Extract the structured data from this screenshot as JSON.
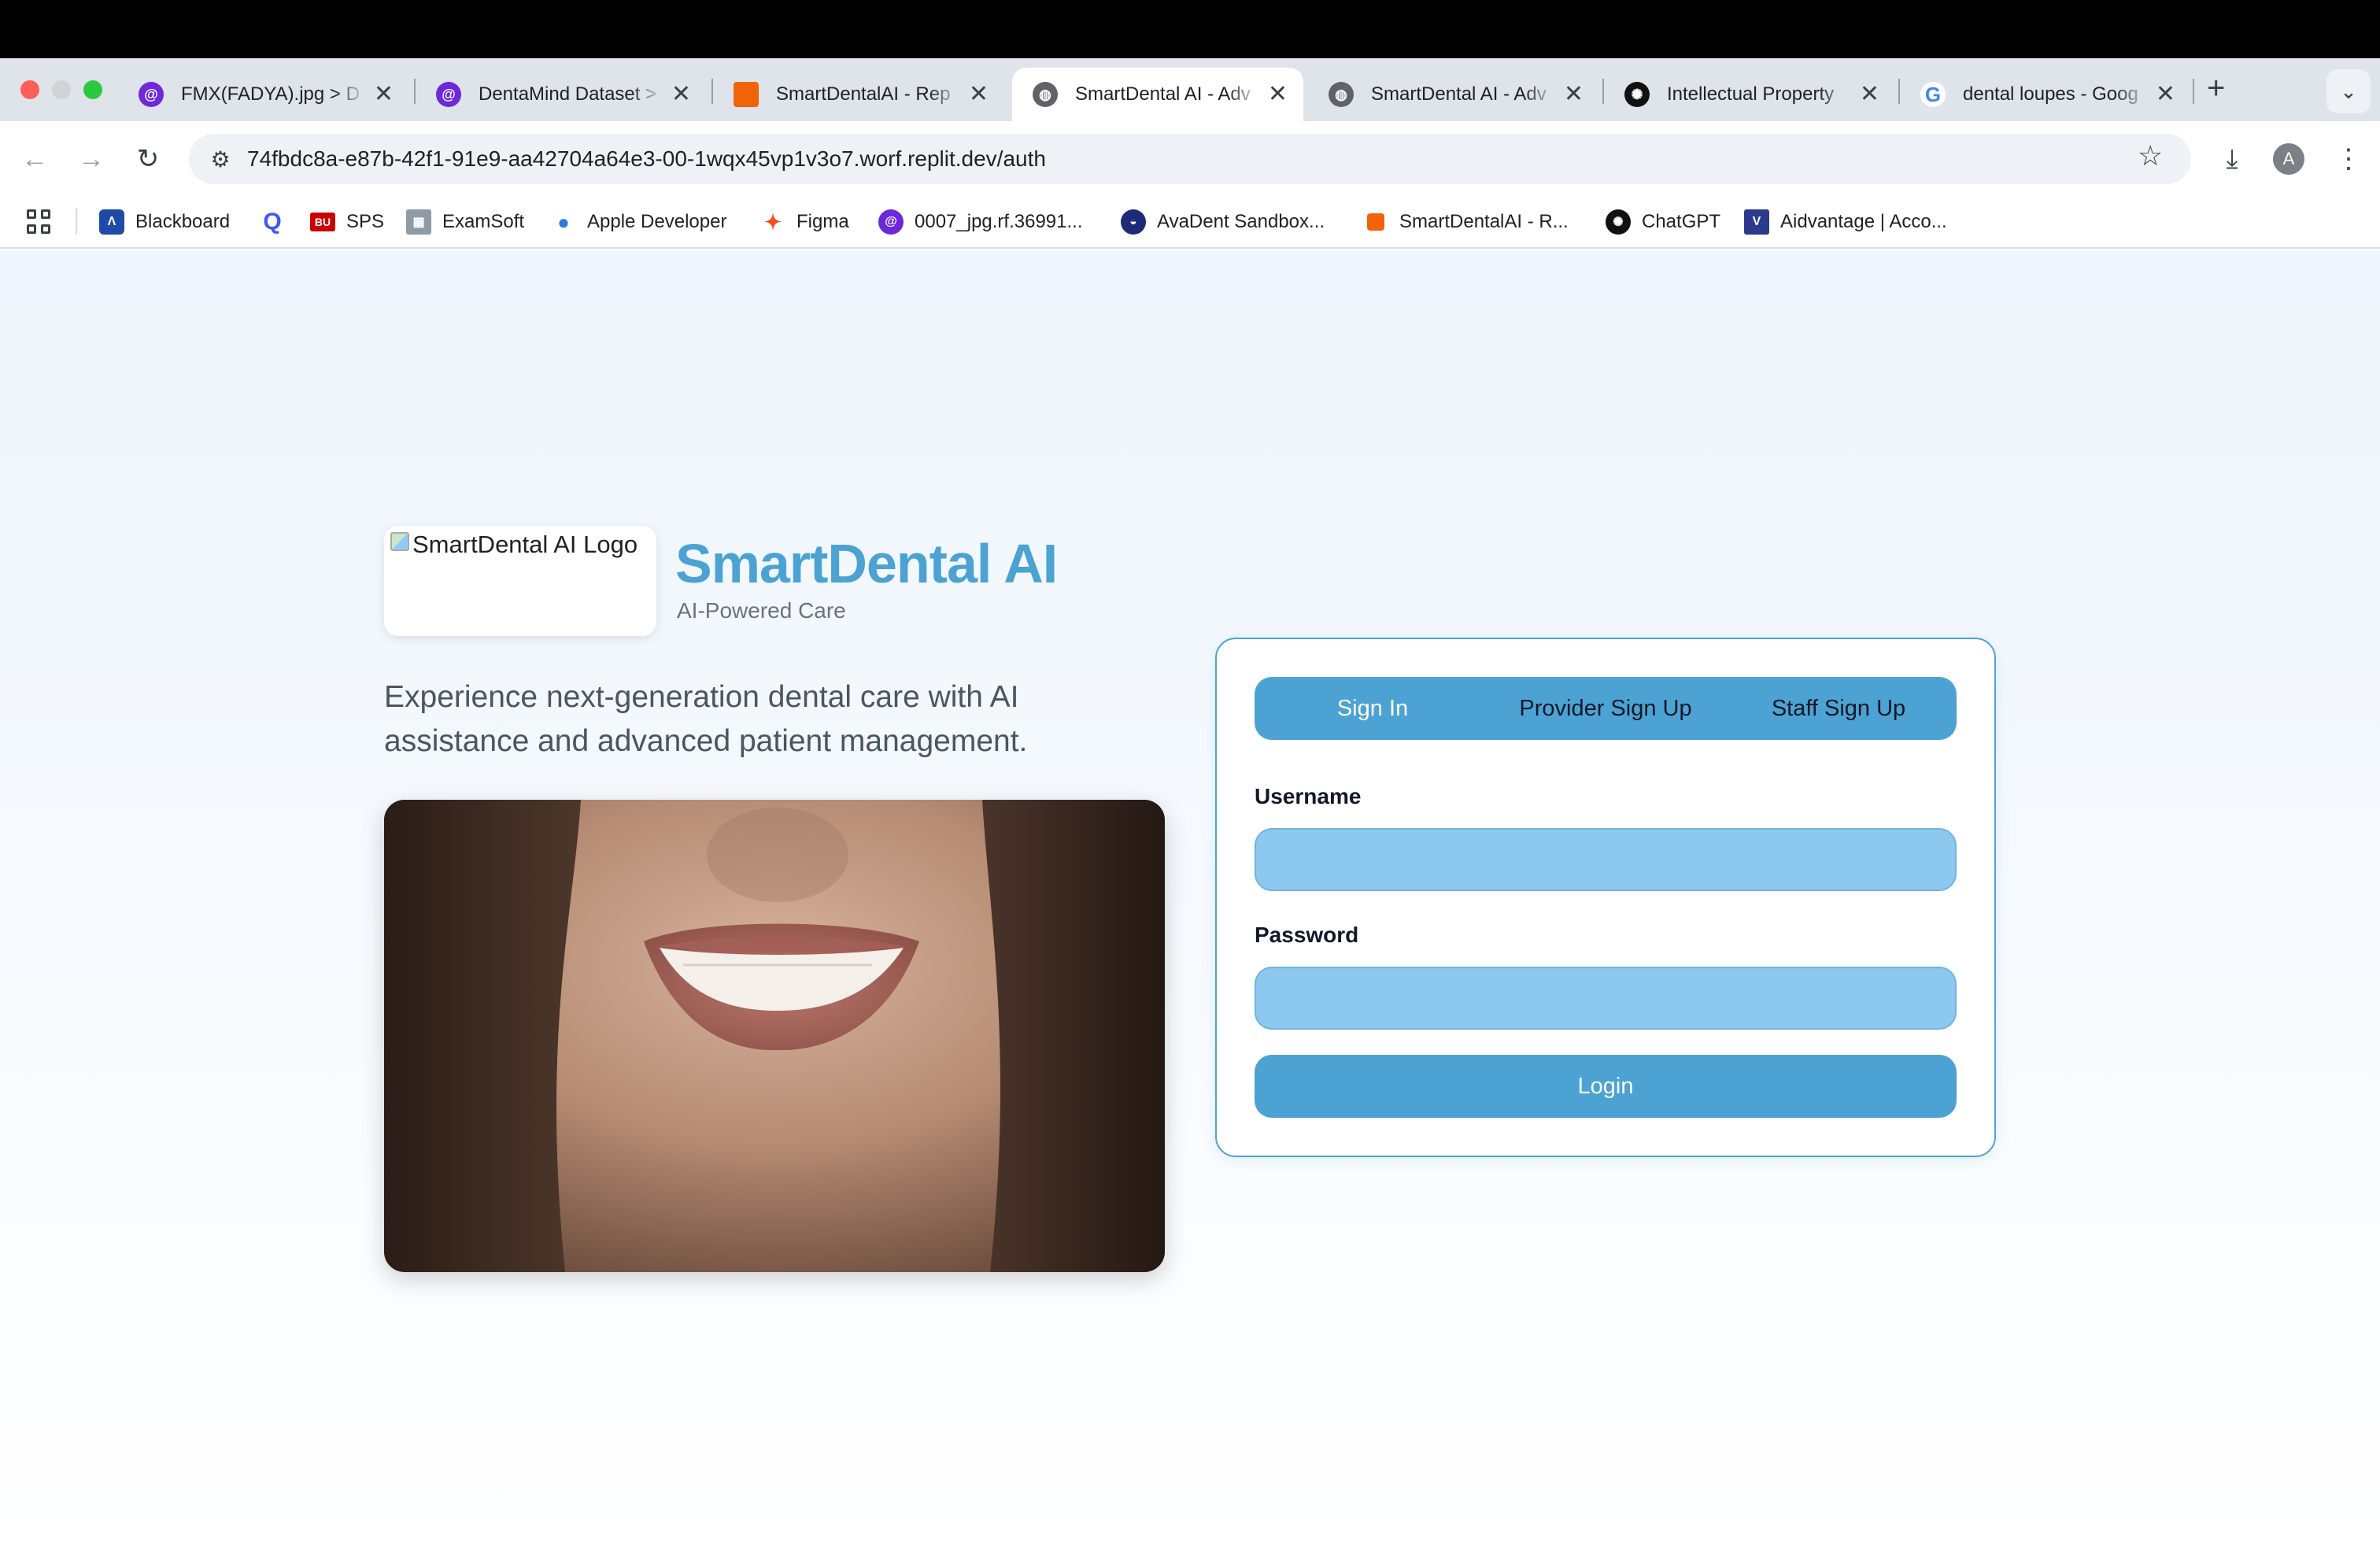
{
  "browser": {
    "tabs": [
      {
        "title": "FMX(FADYA).jpg > D",
        "icon": "roboflow-icon",
        "active": false
      },
      {
        "title": "DentaMind Dataset >",
        "icon": "roboflow-icon",
        "active": false
      },
      {
        "title": "SmartDentalAI - Rep",
        "icon": "replit-icon",
        "active": false
      },
      {
        "title": "SmartDental AI - Adv",
        "icon": "globe-icon",
        "active": true
      },
      {
        "title": "SmartDental AI - Adv",
        "icon": "globe-icon",
        "active": false
      },
      {
        "title": "Intellectual Property",
        "icon": "openai-icon",
        "active": false
      },
      {
        "title": "dental loupes - Goog",
        "icon": "google-icon",
        "active": false
      }
    ],
    "url": "74fbdc8a-e87b-42f1-91e9-aa42704a64e3-00-1wqx45vp1v3o7.worf.replit.dev/auth",
    "profile_initial": "A",
    "bookmarks": [
      {
        "label": "Blackboard",
        "icon": "blackboard-icon"
      },
      {
        "label": "",
        "icon": "quizlet-icon"
      },
      {
        "label": "SPS",
        "icon": "bu-icon"
      },
      {
        "label": "ExamSoft",
        "icon": "examsoft-icon"
      },
      {
        "label": "Apple Developer",
        "icon": "apple-icon"
      },
      {
        "label": "Figma",
        "icon": "figma-icon"
      },
      {
        "label": "0007_jpg.rf.36991...",
        "icon": "roboflow-icon"
      },
      {
        "label": "AvaDent Sandbox...",
        "icon": "avadent-icon"
      },
      {
        "label": "SmartDentalAI - R...",
        "icon": "replit-icon"
      },
      {
        "label": "ChatGPT",
        "icon": "openai-icon"
      },
      {
        "label": "Aidvantage | Acco...",
        "icon": "aidvantage-icon"
      }
    ]
  },
  "brand": {
    "logo_alt": "SmartDental AI Logo",
    "title": "SmartDental AI",
    "subtitle": "AI-Powered Care",
    "tagline": "Experience next-generation dental care with AI assistance and advanced patient management."
  },
  "auth": {
    "tabs": [
      "Sign In",
      "Provider Sign Up",
      "Staff Sign Up"
    ],
    "active_tab": "Sign In",
    "username_label": "Username",
    "username_value": "",
    "password_label": "Password",
    "password_value": "",
    "login_label": "Login"
  },
  "colors": {
    "accent": "#4ca3d3",
    "input_fill": "#8dc9ef"
  }
}
